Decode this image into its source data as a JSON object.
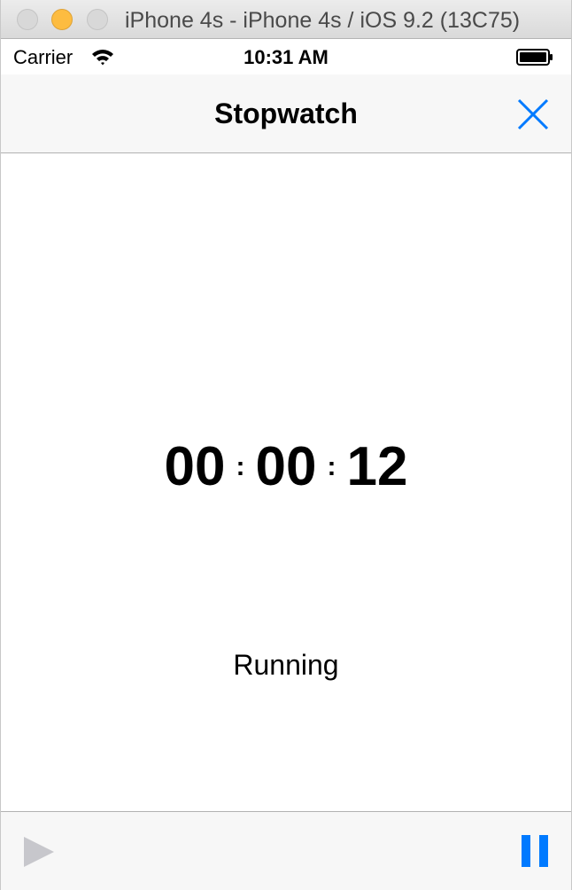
{
  "window": {
    "title": "iPhone 4s - iPhone 4s / iOS 9.2 (13C75)"
  },
  "status_bar": {
    "carrier": "Carrier",
    "time": "10:31 AM",
    "wifi_icon": "wifi-icon",
    "battery_icon": "battery-icon"
  },
  "nav": {
    "title": "Stopwatch",
    "close_icon": "close-icon"
  },
  "stopwatch": {
    "hours": "00",
    "minutes": "00",
    "seconds": "12",
    "separator": ":",
    "state": "Running"
  },
  "toolbar": {
    "play_icon": "play-icon",
    "pause_icon": "pause-icon"
  },
  "colors": {
    "accent": "#007aff",
    "disabled": "#c7c7cc",
    "bar_background": "#f7f7f7"
  }
}
